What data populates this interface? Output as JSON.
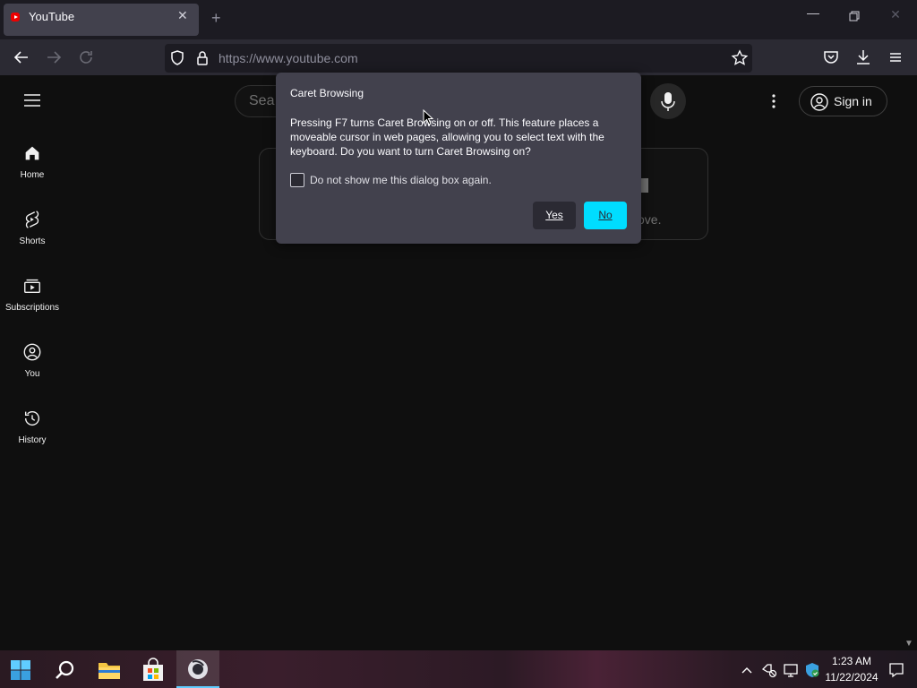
{
  "browser": {
    "tab_title": "YouTube",
    "tab_close": "✕",
    "new_tab": "+",
    "minimize": "—",
    "close": "✕",
    "url": "https://www.youtube.com"
  },
  "youtube": {
    "search_placeholder": "Sea",
    "sign_in": "Sign in",
    "card_partial_text": "ove.",
    "sidebar": [
      {
        "label": "Home",
        "icon": "home-icon"
      },
      {
        "label": "Shorts",
        "icon": "shorts-icon"
      },
      {
        "label": "Subscriptions",
        "icon": "subscriptions-icon"
      },
      {
        "label": "You",
        "icon": "you-icon"
      },
      {
        "label": "History",
        "icon": "history-icon"
      }
    ]
  },
  "dialog": {
    "title": "Caret Browsing",
    "body": "Pressing F7 turns Caret Browsing on or off. This feature places a moveable cursor in web pages, allowing you to select text with the keyboard. Do you want to turn Caret Browsing on?",
    "checkbox_label": "Do not show me this dialog box again.",
    "checkbox_checked": false,
    "yes_label": "Yes",
    "no_label": "No"
  },
  "taskbar": {
    "time": "1:23 AM",
    "date": "11/22/2024",
    "accent": "#60cdff"
  },
  "colors": {
    "dialog_bg": "#42414d",
    "primary_button": "#00ddff",
    "page_bg": "#0f0f0f"
  }
}
